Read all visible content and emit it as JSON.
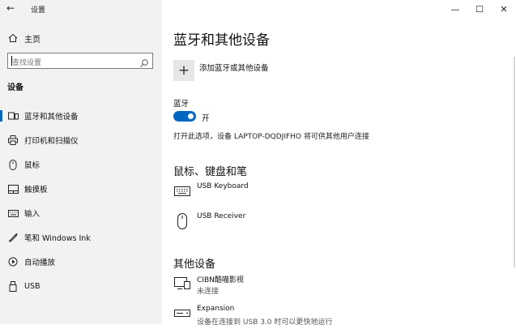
{
  "window": {
    "title": "设置",
    "back_glyph": "←",
    "controls": {
      "minimize": "—",
      "maximize": "☐",
      "close": "✕"
    }
  },
  "sidebar": {
    "home_label": "主页",
    "search_placeholder": "查找设置",
    "section_heading": "设备",
    "items": [
      {
        "label": "蓝牙和其他设备",
        "icon": "bluetooth-devices-icon",
        "active": true
      },
      {
        "label": "打印机和扫描仪",
        "icon": "printer-icon",
        "active": false
      },
      {
        "label": "鼠标",
        "icon": "mouse-icon",
        "active": false
      },
      {
        "label": "触摸板",
        "icon": "touchpad-icon",
        "active": false
      },
      {
        "label": "输入",
        "icon": "keyboard-icon",
        "active": false
      },
      {
        "label": "笔和 Windows Ink",
        "icon": "pen-icon",
        "active": false
      },
      {
        "label": "自动播放",
        "icon": "autoplay-icon",
        "active": false
      },
      {
        "label": "USB",
        "icon": "usb-icon",
        "active": false
      }
    ]
  },
  "main": {
    "title": "蓝牙和其他设备",
    "add_device_label": "添加蓝牙或其他设备",
    "add_glyph": "+",
    "bluetooth_heading": "蓝牙",
    "bluetooth_toggle_state": "开",
    "discoverable_text": "打开此选项，设备 LAPTOP-DQDJIFHO 将可供其他用户连接",
    "mouse_section": {
      "heading": "鼠标、键盘和笔",
      "devices": [
        {
          "name": "USB Keyboard",
          "icon": "keyboard-device-icon"
        },
        {
          "name": "USB Receiver",
          "icon": "mouse-device-icon"
        }
      ]
    },
    "other_section": {
      "heading": "其他设备",
      "devices": [
        {
          "name": "CIBN酷喵影视",
          "status": "未连接",
          "icon": "display-device-icon"
        },
        {
          "name": "Expansion",
          "status": "设备在连接到 USB 3.0 时可以更快地运行",
          "icon": "drive-device-icon"
        }
      ]
    }
  }
}
